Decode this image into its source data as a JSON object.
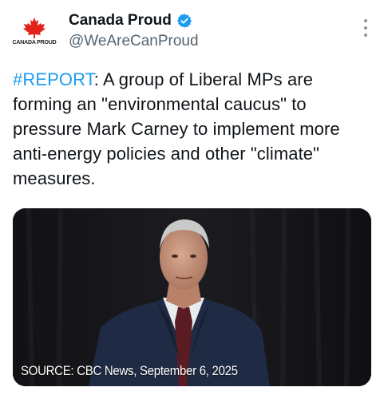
{
  "account": {
    "display_name": "Canada Proud",
    "handle": "@WeAreCanProud",
    "avatar_text": "CANADA PROUD",
    "verified": true
  },
  "tweet": {
    "hashtag": "#REPORT",
    "body": ": A group of Liberal MPs are forming an \"environmental caucus\" to pressure Mark Carney to implement more anti-energy policies and other \"climate\" measures."
  },
  "media": {
    "caption": "SOURCE: CBC News, September 6, 2025"
  },
  "icons": {
    "avatar_logo": "maple-leaf-icon",
    "verified_badge": "verified-badge-icon",
    "more_menu": "more-vertical-icon"
  },
  "colors": {
    "accent": "#1d9bf0",
    "text_primary": "#0f1419",
    "text_secondary": "#536471",
    "maple_red": "#e0241b"
  }
}
